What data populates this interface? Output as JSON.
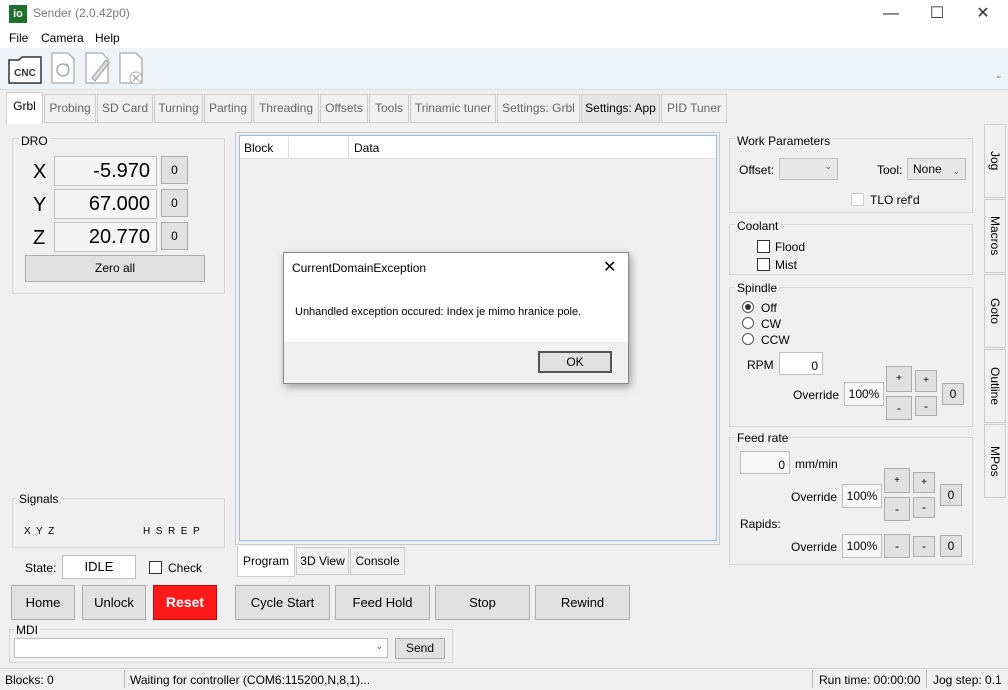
{
  "window": {
    "title": "Sender (2.0.42p0)",
    "icon_text": "io",
    "minimize": "—",
    "maximize": "☐",
    "close": "✕"
  },
  "menu": [
    "File",
    "Camera",
    "Help"
  ],
  "toolbar": {
    "cnc_label": "CNC"
  },
  "tabs": [
    "Grbl",
    "Probing",
    "SD Card",
    "Turning",
    "Parting",
    "Threading",
    "Offsets",
    "Tools",
    "Trinamic tuner",
    "Settings: Grbl",
    "Settings: App",
    "PID Tuner"
  ],
  "dro": {
    "title": "DRO",
    "axes": [
      {
        "name": "X",
        "value": "-5.970",
        "zero": "0"
      },
      {
        "name": "Y",
        "value": "67.000",
        "zero": "0"
      },
      {
        "name": "Z",
        "value": "20.770",
        "zero": "0"
      }
    ],
    "zero_all": "Zero all"
  },
  "signals": {
    "title": "Signals",
    "left": "X  Y  Z",
    "right": "H  S  R  E  P"
  },
  "state": {
    "label": "State:",
    "value": "IDLE",
    "check_label": "Check"
  },
  "grid": {
    "col_block": "Block",
    "col_data": "Data"
  },
  "bottom_tabs": [
    "Program",
    "3D View",
    "Console"
  ],
  "buttons": {
    "home": "Home",
    "unlock": "Unlock",
    "reset": "Reset",
    "cycle_start": "Cycle Start",
    "feed_hold": "Feed Hold",
    "stop": "Stop",
    "rewind": "Rewind"
  },
  "mdi": {
    "label": "MDI",
    "value": "",
    "send": "Send"
  },
  "work": {
    "title": "Work Parameters",
    "offset_label": "Offset:",
    "offset_value": "",
    "tool_label": "Tool:",
    "tool_value": "None",
    "tlo_label": "TLO ref'd"
  },
  "coolant": {
    "title": "Coolant",
    "flood": "Flood",
    "mist": "Mist"
  },
  "spindle": {
    "title": "Spindle",
    "off": "Off",
    "cw": "CW",
    "ccw": "CCW",
    "rpm_label": "RPM",
    "rpm_value": "0",
    "override_label": "Override",
    "override_value": "100%",
    "plus": "+",
    "minus": "-",
    "zero": "0"
  },
  "feed": {
    "title": "Feed rate",
    "value": "0",
    "unit": "mm/min",
    "override_label": "Override",
    "override_value": "100%",
    "rapids_label": "Rapids:",
    "rapids_override_label": "Override",
    "rapids_value": "100%",
    "plus": "+",
    "minus": "-",
    "zero": "0"
  },
  "side_tabs": [
    "Jog",
    "Macros",
    "Goto",
    "Outline",
    "MPos"
  ],
  "dialog": {
    "title": "CurrentDomainException",
    "message": "Unhandled exception occured: Index je mimo hranice pole.",
    "ok": "OK",
    "close": "✕"
  },
  "status": {
    "blocks": "Blocks: 0",
    "message": "Waiting for controller (COM6:115200,N,8,1)...",
    "runtime": "Run time: 00:00:00",
    "jogstep": "Jog step: 0.1"
  },
  "colors": {
    "reset_bg": "#ff1a1a",
    "icon_bg": "#1f6f2d"
  }
}
